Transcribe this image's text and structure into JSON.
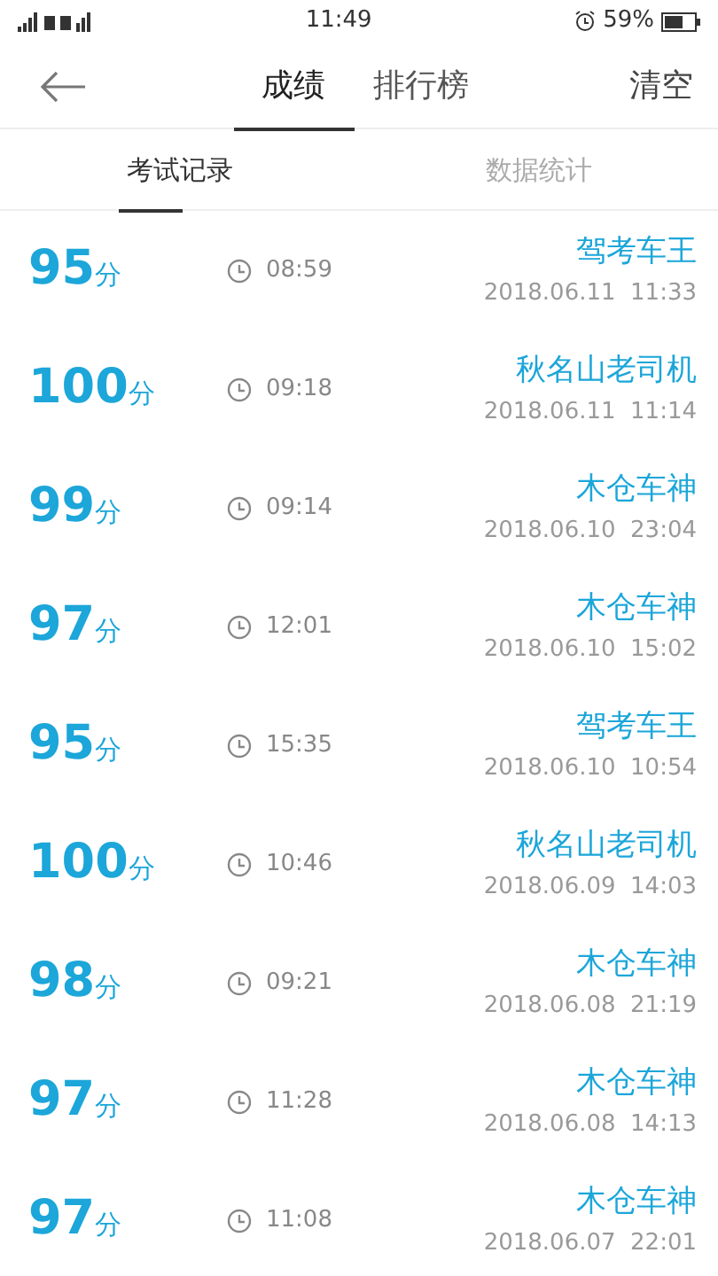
{
  "status_bar": {
    "time": "11:49",
    "battery": "59%"
  },
  "header": {
    "tabs": [
      {
        "label": "成绩",
        "selected": true
      },
      {
        "label": "排行榜",
        "selected": false
      }
    ],
    "action": "清空"
  },
  "sub_tabs": [
    {
      "label": "考试记录",
      "selected": true
    },
    {
      "label": "数据统计",
      "selected": false
    }
  ],
  "records": [
    {
      "score": "95",
      "unit": "分",
      "duration": "08:59",
      "nickname": "驾考车王",
      "date": "2018.06.11  11:33"
    },
    {
      "score": "100",
      "unit": "分",
      "duration": "09:18",
      "nickname": "秋名山老司机",
      "date": "2018.06.11  11:14"
    },
    {
      "score": "99",
      "unit": "分",
      "duration": "09:14",
      "nickname": "木仓车神",
      "date": "2018.06.10  23:04"
    },
    {
      "score": "97",
      "unit": "分",
      "duration": "12:01",
      "nickname": "木仓车神",
      "date": "2018.06.10  15:02"
    },
    {
      "score": "95",
      "unit": "分",
      "duration": "15:35",
      "nickname": "驾考车王",
      "date": "2018.06.10  10:54"
    },
    {
      "score": "100",
      "unit": "分",
      "duration": "10:46",
      "nickname": "秋名山老司机",
      "date": "2018.06.09  14:03"
    },
    {
      "score": "98",
      "unit": "分",
      "duration": "09:21",
      "nickname": "木仓车神",
      "date": "2018.06.08  21:19"
    },
    {
      "score": "97",
      "unit": "分",
      "duration": "11:28",
      "nickname": "木仓车神",
      "date": "2018.06.08  14:13"
    },
    {
      "score": "97",
      "unit": "分",
      "duration": "11:08",
      "nickname": "木仓车神",
      "date": "2018.06.07  22:01"
    }
  ]
}
